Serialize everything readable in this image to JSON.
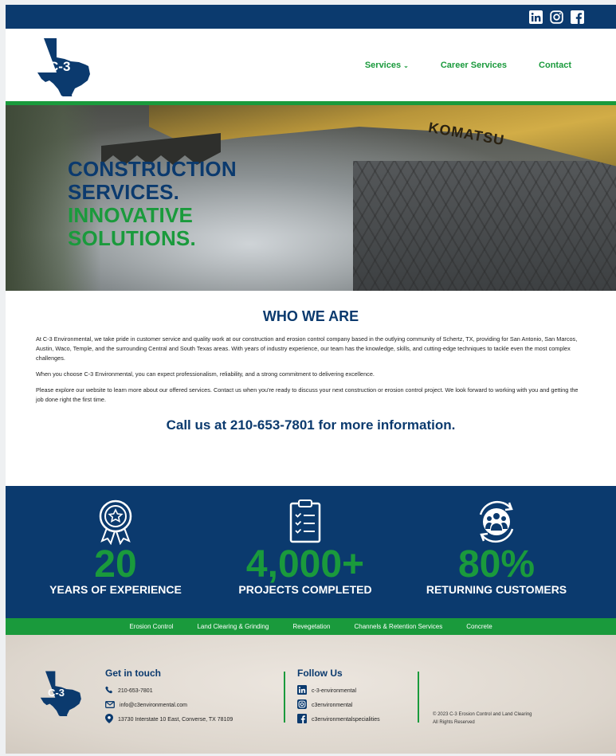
{
  "topbar": {
    "social_icons": [
      "linkedin-icon",
      "instagram-icon",
      "facebook-icon"
    ]
  },
  "header": {
    "logo_text": "C-3",
    "nav": {
      "services": "Services",
      "career_services": "Career Services",
      "contact": "Contact"
    }
  },
  "hero": {
    "line1": "CONSTRUCTION",
    "line2": "SERVICES.",
    "line3": "INNOVATIVE",
    "line4": "SOLUTIONS.",
    "machine_brand": "KOMATSU"
  },
  "who": {
    "heading": "WHO WE ARE",
    "p1": "At C-3 Environmental, we take pride in customer service and quality work at our construction and erosion control company based in the outlying community of Schertz, TX, providing for San Antonio, San Marcos, Austin, Waco, Temple, and the surrounding Central and South Texas areas. With years of industry experience, our team has the knowledge, skills, and cutting-edge techniques to tackle even the most complex challenges.",
    "p2": "When you choose C-3 Environmental, you can expect professionalism, reliability, and a strong commitment to delivering excellence.",
    "p3": "Please explore our website to learn more about our offered services. Contact us when you're ready to discuss your next construction or erosion control project. We look forward to working with you and getting the job done right the first time.",
    "call": "Call us at 210-653-7801 for more information."
  },
  "stats": [
    {
      "icon": "award-ribbon-icon",
      "number": "20",
      "label": "YEARS OF EXPERIENCE"
    },
    {
      "icon": "clipboard-checklist-icon",
      "number": "4,000+",
      "label": "PROJECTS COMPLETED"
    },
    {
      "icon": "returning-customers-icon",
      "number": "80%",
      "label": "RETURNING CUSTOMERS"
    }
  ],
  "services_bar": [
    "Erosion Control",
    "Land Clearing & Grinding",
    "Revegetation",
    "Channels & Retention Services",
    "Concrete"
  ],
  "footer": {
    "logo_text": "C-3",
    "get_in_touch": {
      "heading": "Get in touch",
      "phone": "210-653-7801",
      "email": "info@c3environmental.com",
      "address": "13730 Interstate 10 East, Converse, TX 78109"
    },
    "follow_us": {
      "heading": "Follow Us",
      "linkedin": "c-3-environmental",
      "instagram": "c3environmental",
      "facebook": "c3environmentalspecialities"
    },
    "copyright_line1": "© 2023 C-3 Erosion Control and Land Clearing",
    "copyright_line2": "All Rights Reserved"
  },
  "colors": {
    "navy": "#0b3a6e",
    "green": "#1a9a3c"
  }
}
